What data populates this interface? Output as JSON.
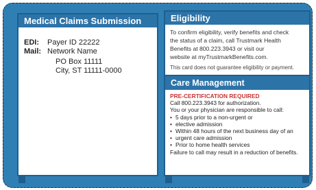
{
  "claims": {
    "header": "Medical Claims Submission",
    "edi_label": "EDI:",
    "edi_value": "Payer ID 22222",
    "mail_label": "Mail:",
    "mail_name": "Network Name",
    "mail_po": "PO Box 11111",
    "mail_city": "City, ST 11111-0000"
  },
  "eligibility": {
    "header": "Eligibility",
    "line1": "To confirm eligibility, verify benefits and check",
    "line2": "the status of a claim, call Trustmark Health",
    "line3": "Benefits at 800.223.3943 or visit our",
    "line4": "website at myTrustmarkBenefits.com.",
    "disclaimer": "This card does not guarantee eligibility or payment."
  },
  "care": {
    "header": "Care Management",
    "required": "PRE-CERTIFICATION REQUIRED",
    "call": "Call 800.223.3943 for authorization.",
    "intro": "You or your physician are responsible to call:",
    "bullets": [
      "5 days prior to a non-urgent or",
      "elective admission",
      "Within 48 hours of the next business day of an",
      "urgent care admission",
      "Prior to home health services"
    ],
    "failure": "Failure to call may result in a reduction of benefits."
  },
  "colors": {
    "card_blue": "#2f7fb4",
    "header_blue": "#2c73a8",
    "alert_red": "#c83232"
  }
}
